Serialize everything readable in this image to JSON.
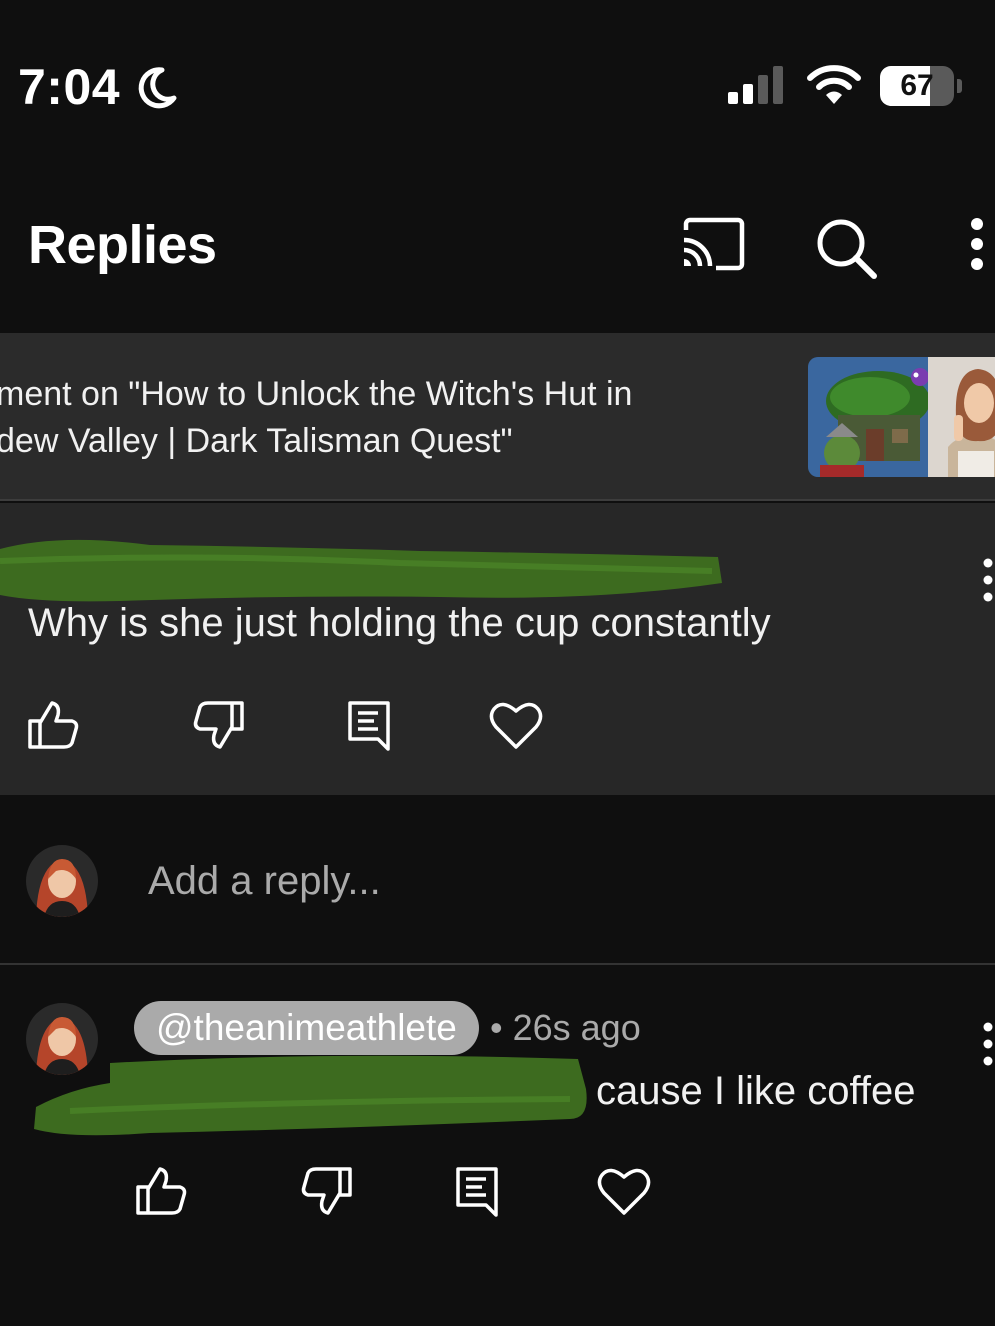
{
  "status_bar": {
    "time": "7:04",
    "battery_percent": "67",
    "battery_level": 0.67,
    "icons": [
      "moon-icon",
      "cellular-signal-icon",
      "wifi-icon",
      "battery-icon"
    ]
  },
  "header": {
    "title": "Replies",
    "icons": [
      "cast-icon",
      "search-icon",
      "more-vertical-icon"
    ]
  },
  "parent": {
    "line1": "ment on \"How to Unlock the Witch's Hut in",
    "line2": "dew Valley | Dark Talisman Quest\""
  },
  "comment": {
    "text": "Why is she just holding the cup constantly",
    "actions": [
      "like-icon",
      "dislike-icon",
      "reply-icon",
      "heart-icon"
    ]
  },
  "composer": {
    "placeholder": "Add a reply..."
  },
  "reply": {
    "handle": "@theanimeathlete",
    "meta": "• 26s ago",
    "text": "cause I like coffee",
    "actions": [
      "like-icon",
      "dislike-icon",
      "reply-icon",
      "heart-icon"
    ]
  },
  "colors": {
    "background": "#0f0f0f",
    "card": "#272727",
    "banner": "#2b2b2b",
    "chip": "#aaaaaa",
    "redaction": "#3d6b1f"
  }
}
